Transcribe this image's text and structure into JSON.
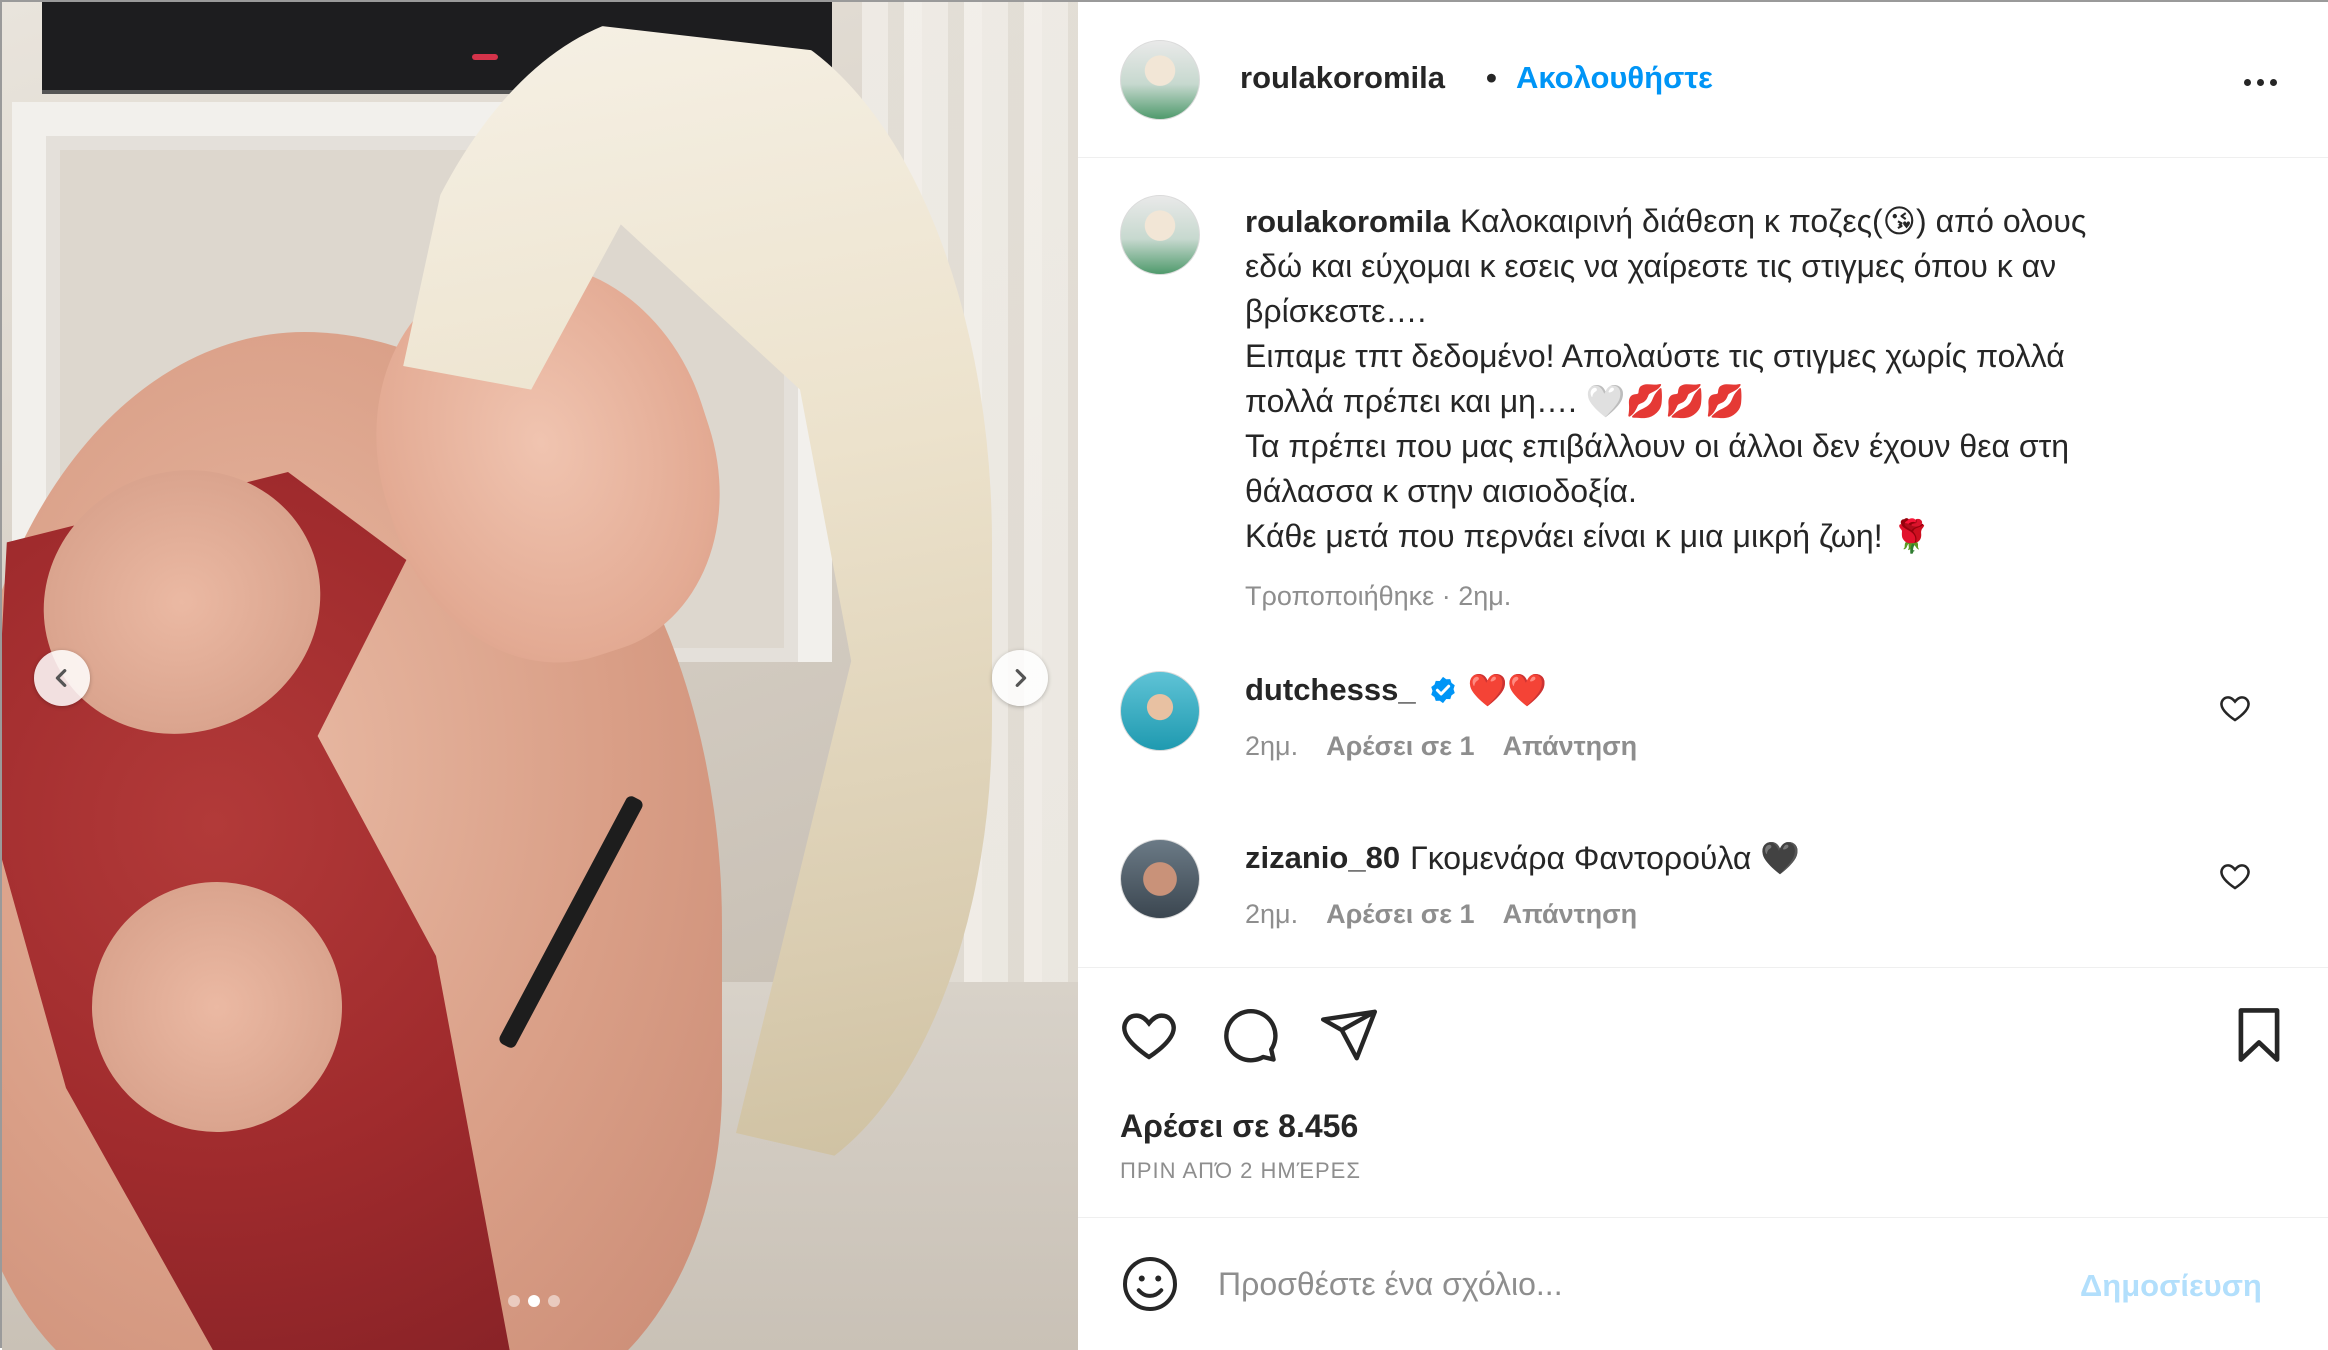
{
  "post": {
    "username": "roulakoromila",
    "follow_label": "Ακολουθήστε",
    "separator": "•",
    "carousel": {
      "total_slides": 3,
      "active_slide": 2
    },
    "caption": {
      "username": "roulakoromila",
      "lines": [
        "Καλοκαιρινή διάθεση κ ποζες(😘) από ολους",
        "εδώ και εύχομαι κ εσεις να χαίρεστε τις στιγμες όπου κ αν",
        "βρίσκεστε….",
        "Ειπαμε τπτ δεδομένο! Απολαύστε τις στιγμες χωρίς πολλά",
        "πολλά πρέπει και μη…. 🤍💋💋💋",
        "Τα πρέπει που μας επιβάλλουν οι άλλοι δεν έχουν θεα στη",
        "θάλασσα κ στην αισιοδοξία.",
        "Κάθε μετά που περνάει είναι κ μια μικρή ζωη! 🌹"
      ],
      "meta": "Τροποποιήθηκε · 2ημ."
    },
    "comments": [
      {
        "username": "dutchesss_",
        "verified": true,
        "text": "❤️❤️",
        "time": "2ημ.",
        "likes": "Αρέσει σε 1",
        "reply": "Απάντηση"
      },
      {
        "username": "zizanio_80",
        "verified": false,
        "text": "Γκομενάρα Φαντορούλα 🖤",
        "time": "2ημ.",
        "likes": "Αρέσει σε 1",
        "reply": "Απάντηση"
      }
    ],
    "likes_label": "Αρέσει σε 8.456",
    "date_label": "ΠΡΙΝ ΑΠΌ 2 ΗΜΈΡΕΣ",
    "add_comment": {
      "placeholder": "Προσθέστε ένα σχόλιο...",
      "post_label": "Δημοσίευση"
    }
  },
  "icons": {
    "prev": "chevron-left-icon",
    "next": "chevron-right-icon",
    "more": "more-options-icon",
    "like": "heart-icon",
    "comment": "comment-icon",
    "share": "send-icon",
    "save": "bookmark-icon",
    "emoji": "emoji-icon",
    "verified": "verified-badge-icon"
  },
  "colors": {
    "accent": "#0095f6",
    "post_disabled": "#b2dffc",
    "muted": "#8e8e8e",
    "text": "#262626"
  }
}
